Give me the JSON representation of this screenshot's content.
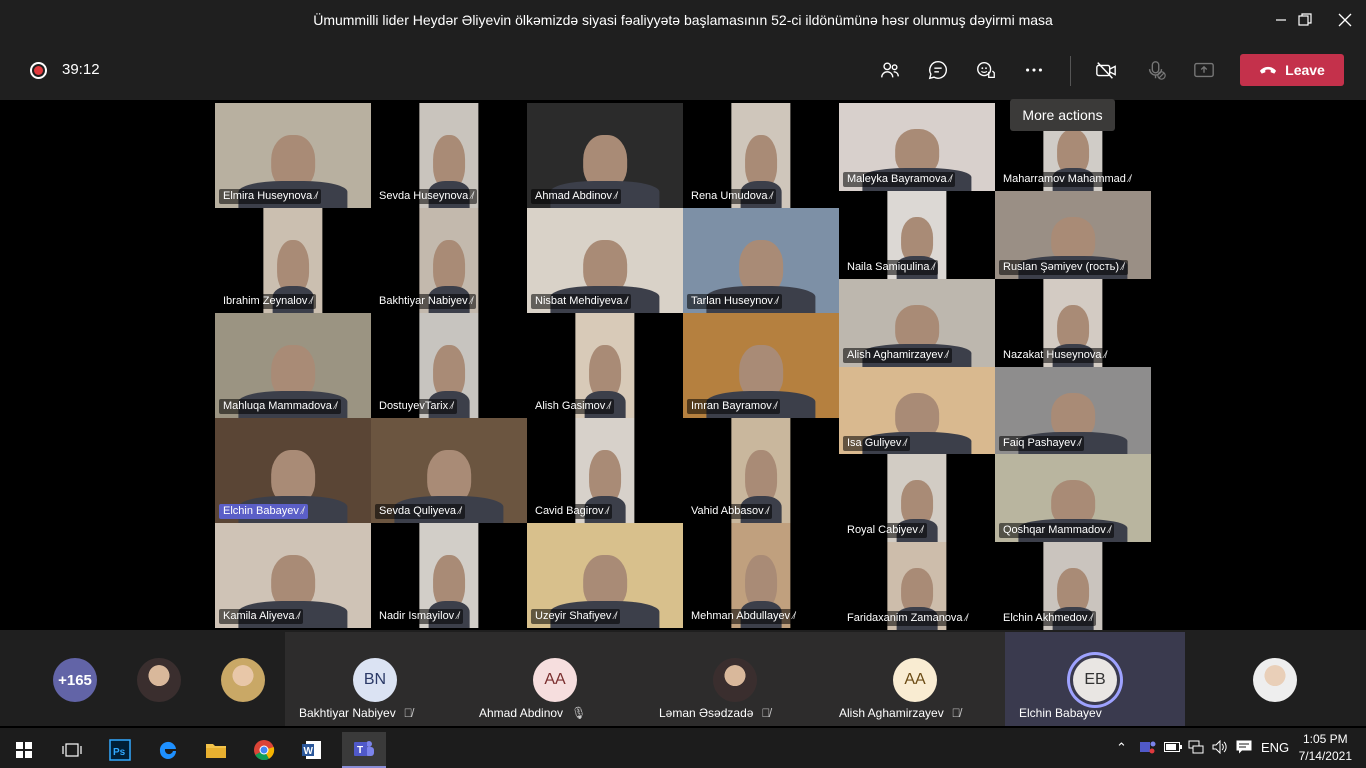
{
  "window": {
    "title": "Ümummilli lider Heydər Əliyevin ölkəmizdə siyasi fəaliyyətə başlamasının 52-ci ildönümünə həsr olunmuş dəyirmi masa",
    "minimize_icon": "minimize-icon",
    "restore_icon": "restore-icon",
    "close_icon": "close-icon"
  },
  "toolbar": {
    "recording_icon": "recording-icon",
    "timer": "39:12",
    "leave_label": "Leave",
    "tooltip": "More actions",
    "accent": "#c4314b"
  },
  "tiles": [
    {
      "name": "Elmira Huseynova",
      "bg": "#b8b0a0",
      "narrow": false
    },
    {
      "name": "Sevda Huseynova",
      "bg": "#c9c4bd",
      "narrow": true
    },
    {
      "name": "Ahmad Abdinov",
      "bg": "#2b2b2b",
      "narrow": false
    },
    {
      "name": "Rena Umudova",
      "bg": "#cfc6bb",
      "narrow": true
    },
    {
      "name": "Maleyka Bayramova",
      "bg": "#d8d0cc",
      "narrow": false
    },
    {
      "name": "Maharramov Mahammad",
      "bg": "#d0ccc7",
      "narrow": true
    },
    {
      "name": "Ibrahim Zeynalov",
      "bg": "#cbbfb0",
      "narrow": true
    },
    {
      "name": "Bakhtiyar Nabiyev",
      "bg": "#c3b9ad",
      "narrow": true
    },
    {
      "name": "Nisbat Mehdiyeva",
      "bg": "#d9d2c8",
      "narrow": false
    },
    {
      "name": "Tarlan Huseynov",
      "bg": "#7d90a6",
      "narrow": false
    },
    {
      "name": "Naila Samiqulina",
      "bg": "#dcd8d4",
      "narrow": true
    },
    {
      "name": "Ruslan Şəmiyev (гость)",
      "bg": "#9a8f85",
      "narrow": false
    },
    {
      "name": "Mahluqa Mammadova",
      "bg": "#9b9482",
      "narrow": false
    },
    {
      "name": "DostuyevTarix",
      "bg": "#c7c4bf",
      "narrow": true
    },
    {
      "name": "Alish Gasimov",
      "bg": "#d8cab8",
      "narrow": true
    },
    {
      "name": "Imran Bayramov",
      "bg": "#b5803f",
      "narrow": false
    },
    {
      "name": "Alish Aghamirzayev",
      "bg": "#bdb7ae",
      "narrow": false
    },
    {
      "name": "Nazakat Huseynova",
      "bg": "#d3cbc3",
      "narrow": true
    },
    {
      "name": "Elchin Babayev",
      "bg": "#5a4535",
      "narrow": false,
      "highlight": true
    },
    {
      "name": "Sevda Quliyeva",
      "bg": "#6b5540",
      "narrow": false
    },
    {
      "name": "Cavid Bagirov",
      "bg": "#d7d1ca",
      "narrow": true
    },
    {
      "name": "Vahid Abbasov",
      "bg": "#c9b79d",
      "narrow": true
    },
    {
      "name": "Isa Guliyev",
      "bg": "#d9b98f",
      "narrow": false
    },
    {
      "name": "Faiq Pashayev",
      "bg": "#8e8d8d",
      "narrow": false
    },
    {
      "name": "Kamila Aliyeva",
      "bg": "#cfc3b6",
      "narrow": false
    },
    {
      "name": "Nadir Ismayilov",
      "bg": "#d2cec8",
      "narrow": true
    },
    {
      "name": "Uzeyir Shafiyev",
      "bg": "#d8c08c",
      "narrow": false
    },
    {
      "name": "Mehman Abdullayev",
      "bg": "#c0a07e",
      "narrow": true
    },
    {
      "name": "Royal Cabiyev",
      "bg": "#d2ccc4",
      "narrow": true
    },
    {
      "name": "Qoshqar Mammadov",
      "bg": "#b9b59f",
      "narrow": false
    },
    {
      "name": "Faridaxanim Zamanova",
      "bg": "#cdbdab",
      "narrow": true
    },
    {
      "name": "Elchin Akhmedov",
      "bg": "#cac4be",
      "narrow": true
    }
  ],
  "bottom": {
    "overflow_count": "+165",
    "participants": [
      {
        "initials": "BN",
        "name": "Bakhtiyar Nabiyev",
        "av_bg": "#dbe3f3",
        "av_fg": "#2b3a67"
      },
      {
        "initials": "AA",
        "name": "Ahmad Abdinov",
        "av_bg": "#f6dede",
        "av_fg": "#7a2e2e"
      },
      {
        "initials": "",
        "name": "Ləman Əsədzadə",
        "av_bg": "#3a2f2f",
        "av_fg": "#fff"
      },
      {
        "initials": "AA",
        "name": "Alish Aghamirzayev",
        "av_bg": "#f9ecd2",
        "av_fg": "#6b4b14"
      },
      {
        "initials": "EB",
        "name": "Elchin Babayev",
        "av_bg": "#e9e6e3",
        "av_fg": "#333"
      }
    ]
  },
  "taskbar": {
    "start_icon": "windows-start-icon",
    "lang": "ENG",
    "time": "1:05 PM",
    "date": "7/14/2021"
  }
}
